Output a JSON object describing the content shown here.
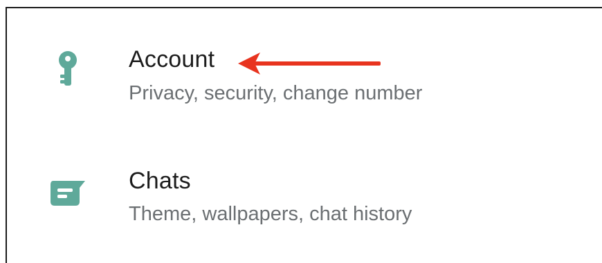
{
  "settings": {
    "items": [
      {
        "title": "Account",
        "subtitle": "Privacy, security, change number",
        "icon": "key-icon"
      },
      {
        "title": "Chats",
        "subtitle": "Theme, wallpapers, chat history",
        "icon": "chat-icon"
      }
    ]
  },
  "colors": {
    "icon_teal": "#5fa99a",
    "arrow_red": "#e8341f",
    "title_text": "#1c1c1c",
    "subtitle_text": "#6b6f72"
  }
}
